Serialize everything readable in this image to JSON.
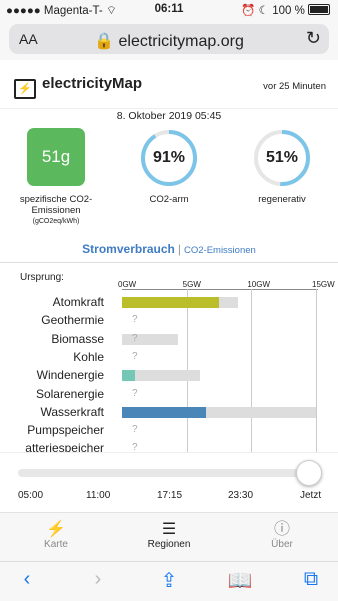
{
  "status": {
    "carrier": "●●●●● Magenta-T-",
    "wifi_icon": "wifi-icon",
    "time": "06:11",
    "battery_text": "100 %"
  },
  "browser": {
    "aa": "AA",
    "url": "electricitymap.org",
    "reload_icon": "reload-icon"
  },
  "app": {
    "name": "electricityMap",
    "updated_ago": "vor 25 Minuten",
    "datetime": "8. Oktober 2019 05:45"
  },
  "metrics": {
    "intensity": {
      "value": "51g",
      "label_line1": "spezifische CO2-",
      "label_line2": "Emissionen",
      "unit": "(gCO2eq/kWh)",
      "color": "#5cb85c"
    },
    "low_carbon": {
      "value": "91%",
      "percent": 0.91,
      "label": "CO2-arm",
      "color": "#7cc5e8"
    },
    "renewable": {
      "value": "51%",
      "percent": 0.51,
      "label": "regenerativ",
      "color": "#7cc5e8"
    }
  },
  "tabs": {
    "active": "Stromverbrauch",
    "separator": "|",
    "other": "CO2-Emissionen"
  },
  "chart_data": {
    "type": "bar",
    "title": "Ursprung:",
    "xticks": [
      "0GW",
      "5GW",
      "10GW",
      "15GW"
    ],
    "xlim": [
      0,
      15
    ],
    "categories": [
      "Atomkraft",
      "Geothermie",
      "Biomasse",
      "Kohle",
      "Windenergie",
      "Solarenergie",
      "Wasserkraft",
      "Pumpspeicher",
      "atteriespeicher"
    ],
    "production": [
      7.5,
      null,
      0,
      0,
      1.0,
      null,
      6.5,
      null,
      null
    ],
    "capacity": [
      9.0,
      null,
      4.3,
      0,
      6.0,
      null,
      15.0,
      null,
      null
    ],
    "unknown_marker": "?",
    "colors": {
      "Atomkraft": "#b9be2a",
      "Windenergie": "#73c7b4",
      "Wasserkraft": "#4a86b8",
      "capacity": "#dddddd"
    }
  },
  "slider": {
    "labels": [
      "05:00",
      "11:00",
      "17:15",
      "23:30",
      "Jetzt"
    ],
    "position": 1.0
  },
  "bottom_nav": {
    "items": [
      {
        "label": "Karte",
        "icon": "map-icon"
      },
      {
        "label": "Regionen",
        "icon": "list-icon"
      },
      {
        "label": "Über",
        "icon": "info-icon"
      }
    ]
  },
  "safari": {
    "icons": [
      "back-icon",
      "forward-icon",
      "share-icon",
      "bookmarks-icon",
      "tabs-icon"
    ]
  }
}
